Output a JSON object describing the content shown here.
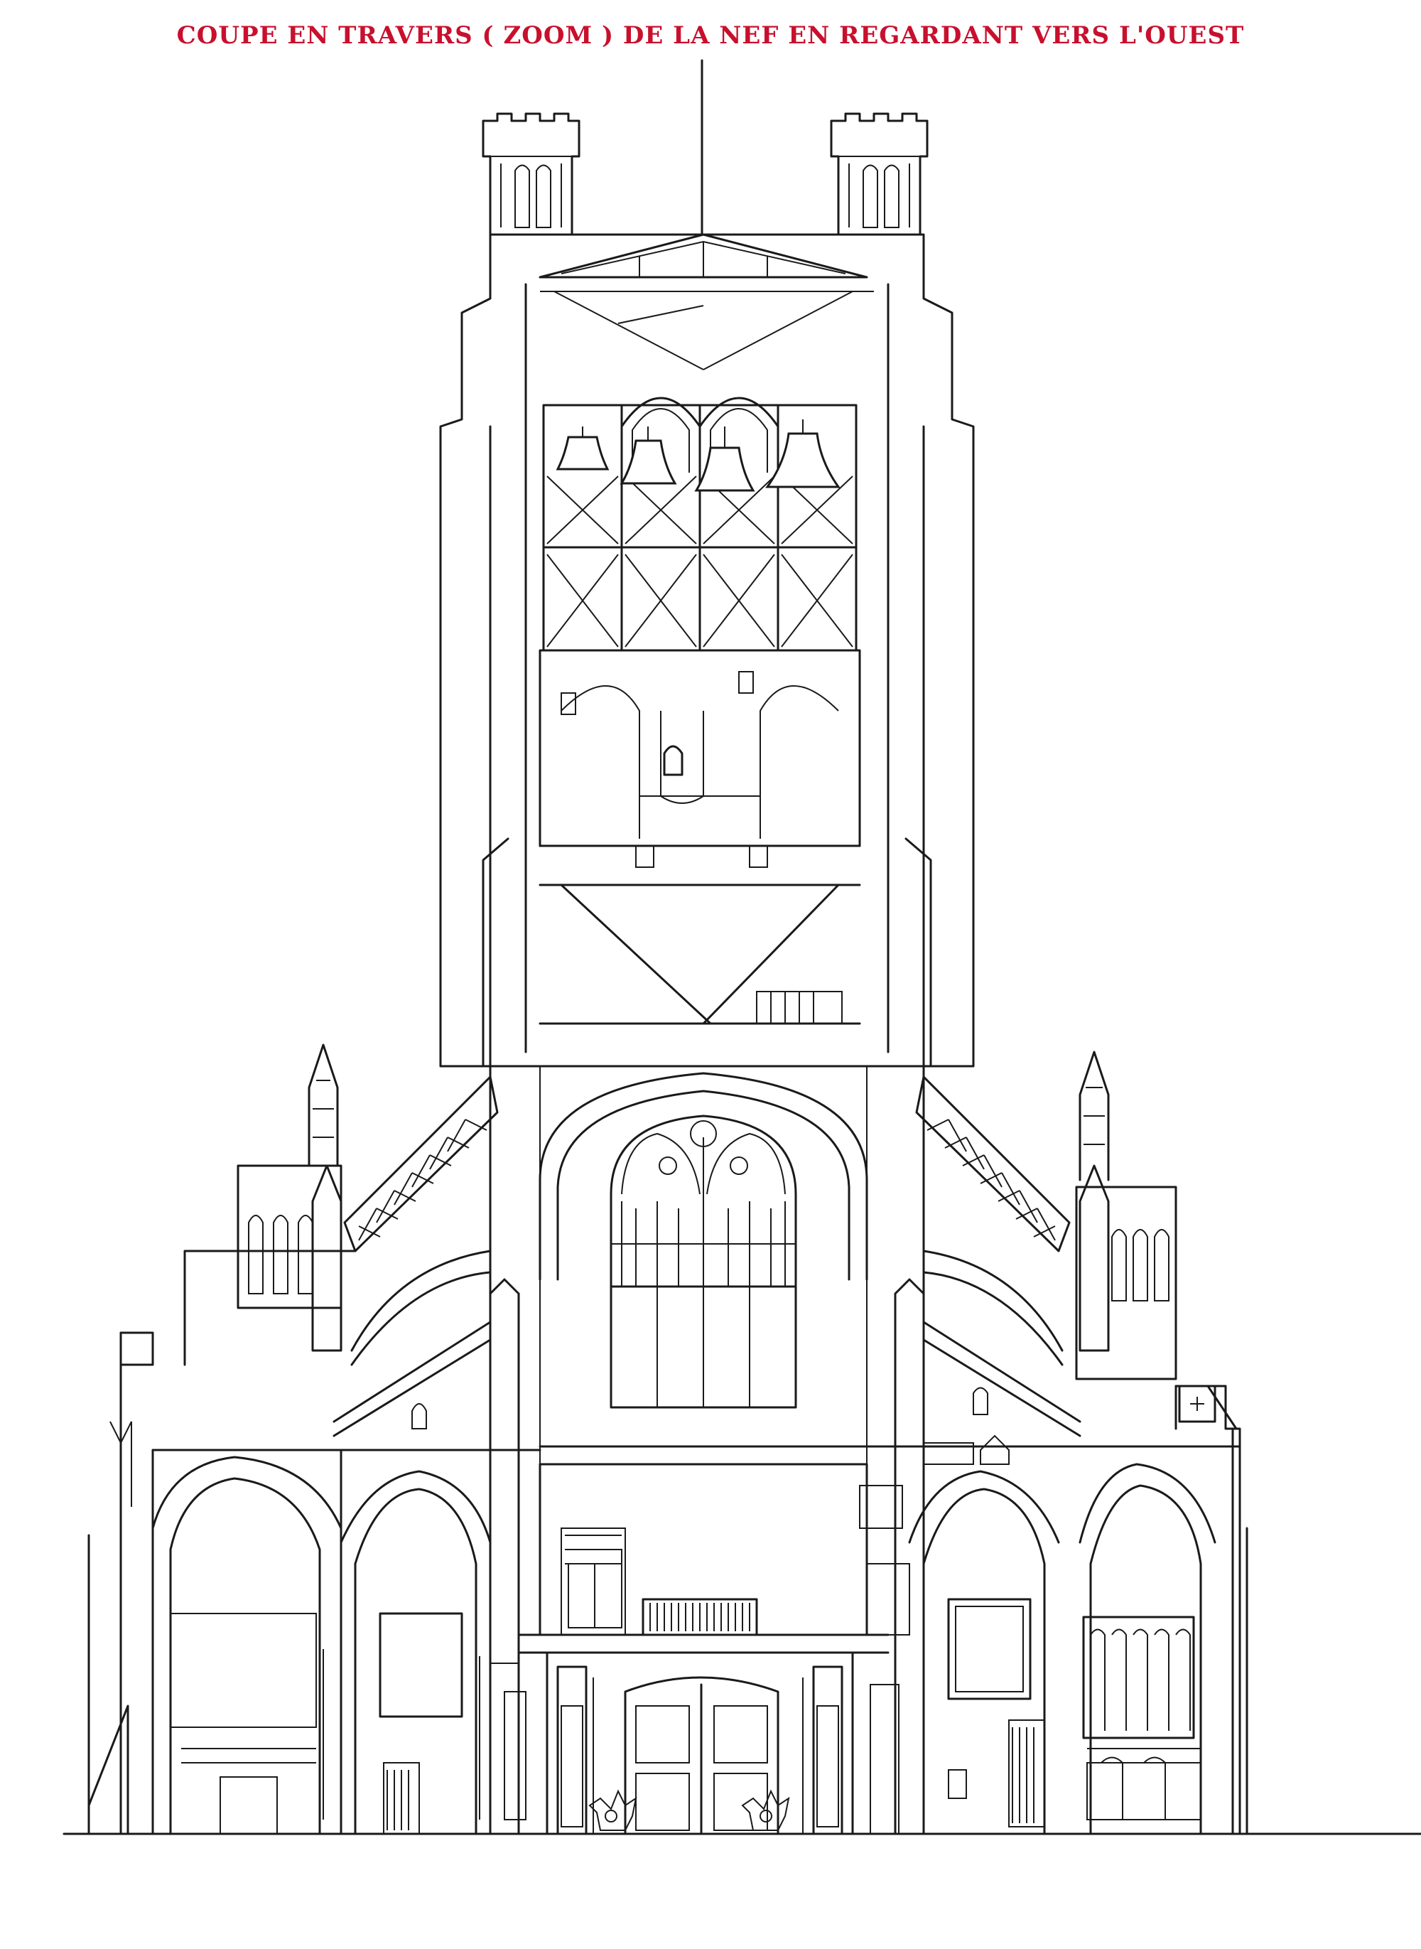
{
  "title": "COUPE EN TRAVERS ( ZOOM ) DE LA NEF EN REGARDANT VERS L'OUEST",
  "colors": {
    "title": "#c8102e",
    "line": "#1a1a1a",
    "background": "#ffffff"
  }
}
